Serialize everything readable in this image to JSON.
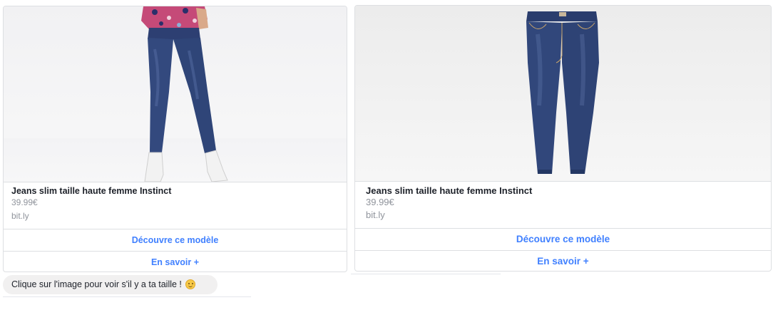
{
  "cards": [
    {
      "title": "Jeans slim taille haute femme Instinct",
      "price": "39.99€",
      "domain": "bit.ly",
      "buttons": [
        "Découvre ce modèle",
        "En savoir +"
      ],
      "image": "jeans-model-photo"
    },
    {
      "title": "Jeans slim taille haute femme Instinct",
      "price": "39.99€",
      "domain": "bit.ly",
      "buttons": [
        "Découvre ce modèle",
        "En savoir +"
      ],
      "image": "jeans-product-photo"
    }
  ],
  "message": {
    "text": "Clique sur l'image pour voir s'il y a ta taille !",
    "emoji": "slightly-smiling-face-emoji"
  },
  "colors": {
    "link": "#4080ff",
    "border": "#dddfe2",
    "bubble": "#f1f0f0",
    "denim": "#2f4578"
  }
}
